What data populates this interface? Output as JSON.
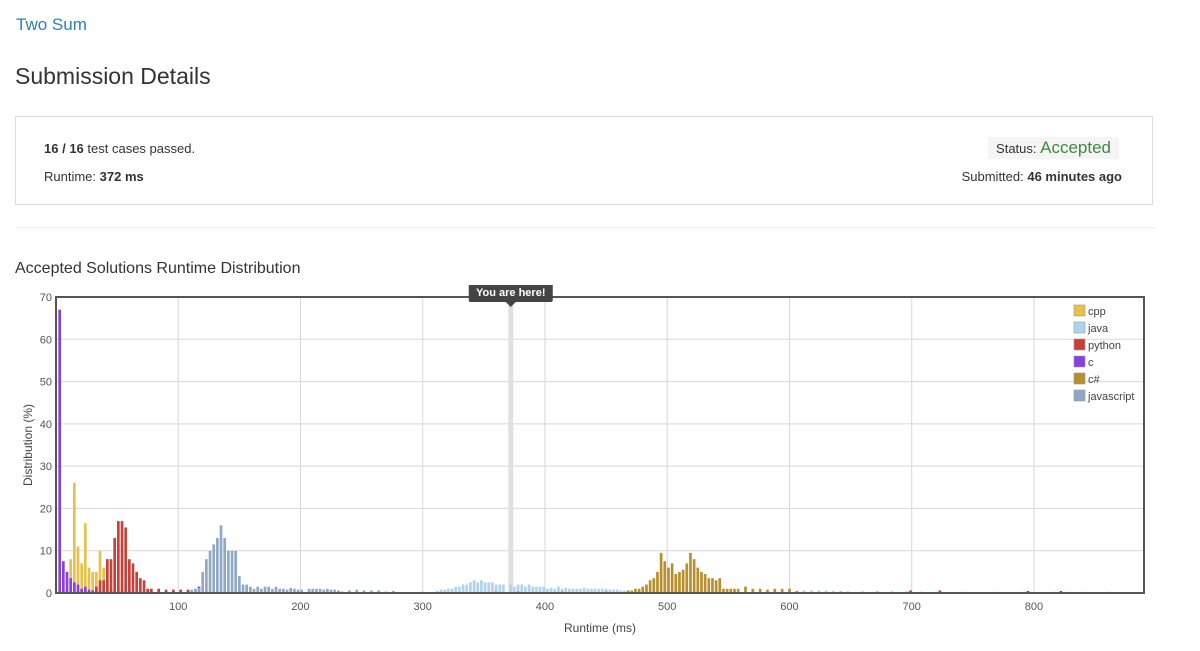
{
  "problem_link": "Two Sum",
  "page_title": "Submission Details",
  "summary": {
    "passed": "16",
    "separator": " / ",
    "total": "16",
    "passed_suffix": " test cases passed.",
    "runtime_label": "Runtime: ",
    "runtime_value": "372 ms",
    "status_label": "Status: ",
    "status_value": "Accepted",
    "submitted_label": "Submitted: ",
    "submitted_value": "46 minutes ago"
  },
  "chart_title": "Accepted Solutions Runtime Distribution",
  "tooltip": "You are here!",
  "colors": {
    "cpp": "#e8c04b",
    "java": "#aed3f2",
    "python": "#c6413a",
    "c": "#8a3fe0",
    "c#": "#b88f2c",
    "javascript": "#8fa9c4",
    "marker": "#e0e0e0",
    "grid": "#d8d8d8"
  },
  "chart_data": {
    "type": "bar",
    "title": "Accepted Solutions Runtime Distribution",
    "xlabel": "Runtime (ms)",
    "ylabel": "Distribution (%)",
    "xlim": [
      0,
      890
    ],
    "ylim": [
      0,
      70
    ],
    "xticks": [
      100,
      200,
      300,
      400,
      500,
      600,
      700,
      800
    ],
    "yticks": [
      0,
      10,
      20,
      30,
      40,
      50,
      60,
      70
    ],
    "grid": true,
    "legend_position": "top-right",
    "marker_x": 372,
    "bar_width_ms": 3,
    "series": [
      {
        "name": "cpp",
        "points": [
          [
            6,
            0.8
          ],
          [
            9,
            1.2
          ],
          [
            12,
            8
          ],
          [
            15,
            26
          ],
          [
            18,
            11
          ],
          [
            21,
            7
          ],
          [
            24,
            16.5
          ],
          [
            27,
            6
          ],
          [
            30,
            5
          ],
          [
            33,
            5
          ],
          [
            36,
            10
          ],
          [
            39,
            6
          ],
          [
            42,
            2
          ],
          [
            45,
            1.2
          ],
          [
            48,
            0.8
          ],
          [
            54,
            0.5
          ],
          [
            60,
            0.5
          ],
          [
            84,
            0.4
          ],
          [
            126,
            0.3
          ],
          [
            186,
            0.3
          ],
          [
            240,
            0.3
          ],
          [
            300,
            0.3
          ]
        ]
      },
      {
        "name": "java",
        "points": [
          [
            300,
            0.3
          ],
          [
            312,
            0.5
          ],
          [
            315,
            0.8
          ],
          [
            318,
            0.8
          ],
          [
            321,
            1
          ],
          [
            324,
            1
          ],
          [
            327,
            1.5
          ],
          [
            330,
            1.5
          ],
          [
            333,
            2
          ],
          [
            336,
            2
          ],
          [
            339,
            2.5
          ],
          [
            342,
            3
          ],
          [
            345,
            2.5
          ],
          [
            348,
            3
          ],
          [
            351,
            2.5
          ],
          [
            354,
            2.5
          ],
          [
            357,
            2.5
          ],
          [
            360,
            2
          ],
          [
            363,
            2
          ],
          [
            366,
            2
          ],
          [
            372,
            2
          ],
          [
            375,
            1.5
          ],
          [
            378,
            2
          ],
          [
            381,
            2
          ],
          [
            384,
            1.5
          ],
          [
            387,
            2
          ],
          [
            390,
            1.5
          ],
          [
            393,
            1.5
          ],
          [
            396,
            1.5
          ],
          [
            399,
            1.5
          ],
          [
            402,
            1
          ],
          [
            405,
            1.2
          ],
          [
            408,
            1
          ],
          [
            411,
            1.5
          ],
          [
            414,
            1
          ],
          [
            417,
            1.2
          ],
          [
            420,
            1
          ],
          [
            423,
            1
          ],
          [
            426,
            1
          ],
          [
            429,
            1
          ],
          [
            432,
            1.2
          ],
          [
            435,
            1
          ],
          [
            438,
            1
          ],
          [
            441,
            1
          ],
          [
            444,
            1
          ],
          [
            447,
            1
          ],
          [
            450,
            1
          ],
          [
            453,
            0.8
          ],
          [
            456,
            0.8
          ],
          [
            459,
            0.8
          ],
          [
            462,
            0.6
          ],
          [
            465,
            0.6
          ],
          [
            534,
            0.4
          ],
          [
            540,
            0.4
          ],
          [
            552,
            0.4
          ],
          [
            564,
            0.4
          ],
          [
            576,
            0.4
          ],
          [
            612,
            0.6
          ],
          [
            618,
            0.6
          ],
          [
            624,
            0.6
          ],
          [
            630,
            0.6
          ],
          [
            636,
            0.5
          ],
          [
            642,
            0.5
          ],
          [
            660,
            0.4
          ],
          [
            672,
            0.4
          ],
          [
            684,
            0.4
          ],
          [
            696,
            0.4
          ],
          [
            708,
            0.3
          ],
          [
            720,
            0.3
          ],
          [
            744,
            0.3
          ],
          [
            768,
            0.3
          ],
          [
            792,
            0.3
          ],
          [
            816,
            0.3
          ],
          [
            840,
            0.3
          ],
          [
            861,
            0.3
          ]
        ]
      },
      {
        "name": "python",
        "points": [
          [
            33,
            1.5
          ],
          [
            36,
            3
          ],
          [
            39,
            3
          ],
          [
            42,
            8
          ],
          [
            45,
            8
          ],
          [
            48,
            13
          ],
          [
            51,
            17
          ],
          [
            54,
            17
          ],
          [
            57,
            15.5
          ],
          [
            60,
            8
          ],
          [
            63,
            7
          ],
          [
            66,
            5
          ],
          [
            69,
            3.5
          ],
          [
            72,
            3
          ],
          [
            75,
            1
          ],
          [
            78,
            1
          ],
          [
            84,
            1
          ],
          [
            90,
            0.8
          ],
          [
            96,
            0.8
          ],
          [
            102,
            0.8
          ],
          [
            108,
            0.8
          ],
          [
            114,
            0.5
          ],
          [
            150,
            0.5
          ],
          [
            156,
            0.5
          ],
          [
            168,
            0.3
          ],
          [
            198,
            0.3
          ],
          [
            234,
            0.3
          ],
          [
            270,
            0.3
          ],
          [
            360,
            0.3
          ],
          [
            378,
            0.3
          ],
          [
            414,
            0.3
          ],
          [
            450,
            0.3
          ],
          [
            510,
            0.3
          ],
          [
            570,
            0.3
          ],
          [
            600,
            0.3
          ],
          [
            648,
            0.3
          ],
          [
            672,
            0.3
          ],
          [
            699,
            0.6
          ],
          [
            723,
            0.6
          ],
          [
            795,
            0.5
          ],
          [
            822,
            0.5
          ]
        ]
      },
      {
        "name": "c",
        "points": [
          [
            3,
            67
          ],
          [
            6,
            7.5
          ],
          [
            9,
            5
          ],
          [
            12,
            3.5
          ],
          [
            15,
            2.5
          ],
          [
            18,
            2
          ],
          [
            21,
            1
          ],
          [
            24,
            1.5
          ],
          [
            27,
            0.8
          ],
          [
            30,
            0.6
          ],
          [
            36,
            0.5
          ],
          [
            48,
            0.5
          ],
          [
            60,
            0.5
          ],
          [
            72,
            0.4
          ],
          [
            84,
            0.4
          ],
          [
            96,
            0.4
          ],
          [
            108,
            0.4
          ],
          [
            117,
            1.5
          ],
          [
            210,
            0.4
          ],
          [
            240,
            0.4
          ],
          [
            264,
            0.4
          ]
        ]
      },
      {
        "name": "c#",
        "points": [
          [
            468,
            0.6
          ],
          [
            471,
            0.6
          ],
          [
            474,
            1
          ],
          [
            477,
            1
          ],
          [
            480,
            1.5
          ],
          [
            483,
            2
          ],
          [
            486,
            3
          ],
          [
            489,
            3.5
          ],
          [
            492,
            5
          ],
          [
            495,
            9.5
          ],
          [
            498,
            7.5
          ],
          [
            501,
            6
          ],
          [
            504,
            7
          ],
          [
            507,
            4.5
          ],
          [
            510,
            5
          ],
          [
            513,
            5.5
          ],
          [
            516,
            7
          ],
          [
            519,
            9.5
          ],
          [
            522,
            8
          ],
          [
            525,
            6
          ],
          [
            528,
            5
          ],
          [
            531,
            4.5
          ],
          [
            534,
            3.5
          ],
          [
            537,
            3.5
          ],
          [
            540,
            3
          ],
          [
            543,
            3.5
          ],
          [
            546,
            1
          ],
          [
            549,
            1
          ],
          [
            552,
            1
          ],
          [
            555,
            1
          ],
          [
            558,
            1
          ],
          [
            564,
            1.5
          ],
          [
            570,
            1
          ],
          [
            576,
            1
          ],
          [
            582,
            0.8
          ],
          [
            588,
            1
          ],
          [
            594,
            1
          ],
          [
            600,
            1
          ],
          [
            606,
            0.5
          ]
        ]
      },
      {
        "name": "javascript",
        "points": [
          [
            111,
            0.8
          ],
          [
            114,
            1
          ],
          [
            117,
            1.2
          ],
          [
            120,
            5
          ],
          [
            123,
            8
          ],
          [
            126,
            10
          ],
          [
            129,
            11.5
          ],
          [
            132,
            13
          ],
          [
            135,
            16
          ],
          [
            138,
            13
          ],
          [
            141,
            10
          ],
          [
            144,
            10
          ],
          [
            147,
            10
          ],
          [
            150,
            4
          ],
          [
            153,
            2
          ],
          [
            156,
            2
          ],
          [
            159,
            1.5
          ],
          [
            162,
            1
          ],
          [
            165,
            1.5
          ],
          [
            168,
            1
          ],
          [
            171,
            1.5
          ],
          [
            174,
            1.5
          ],
          [
            177,
            1
          ],
          [
            180,
            1.5
          ],
          [
            183,
            1
          ],
          [
            186,
            1
          ],
          [
            189,
            0.8
          ],
          [
            192,
            1.2
          ],
          [
            195,
            1
          ],
          [
            198,
            0.8
          ],
          [
            201,
            0.8
          ],
          [
            207,
            1
          ],
          [
            210,
            1
          ],
          [
            213,
            1
          ],
          [
            216,
            1
          ],
          [
            219,
            0.8
          ],
          [
            222,
            1
          ],
          [
            225,
            0.8
          ],
          [
            228,
            0.8
          ],
          [
            231,
            0.6
          ],
          [
            240,
            0.6
          ],
          [
            246,
            0.8
          ],
          [
            252,
            0.6
          ],
          [
            258,
            0.6
          ],
          [
            264,
            0.6
          ],
          [
            276,
            0.5
          ]
        ]
      }
    ]
  }
}
